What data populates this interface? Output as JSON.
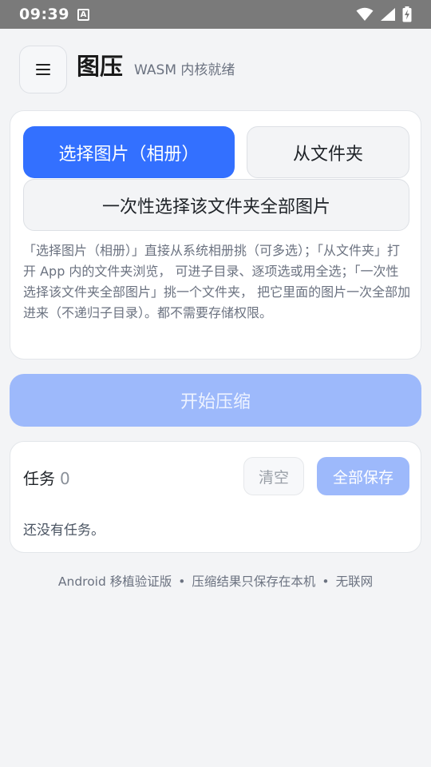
{
  "status_bar": {
    "time": "09:39",
    "notification_glyph": "A"
  },
  "header": {
    "title": "图压",
    "subtitle": "WASM 内核就绪"
  },
  "picker": {
    "pick_images_label": "选择图片（相册）",
    "from_folder_label": "从文件夹",
    "pick_whole_folder_label": "一次性选择该文件夹全部图片",
    "hint": "「选择图片（相册）」直接从系统相册挑（可多选）；「从文件夹」打开 App 内的文件夹浏览， 可进子目录、逐项选或用全选；「一次性选择该文件夹全部图片」挑一个文件夹， 把它里面的图片一次全部加进来（不递归子目录）。都不需要存储权限。"
  },
  "start_button_label": "开始压缩",
  "tasks": {
    "label": "任务",
    "count": "0",
    "clear_label": "清空",
    "save_all_label": "全部保存",
    "empty_text": "还没有任务。"
  },
  "footer": {
    "part1": "Android 移植验证版",
    "part2": "压缩结果只保存在本机",
    "part3": "无联网",
    "separator": "•"
  },
  "colors": {
    "primary": "#3370ff",
    "primary_disabled": "#9db9fb",
    "status_bar": "#7a7a7a",
    "background": "#f3f4f6"
  },
  "icons": {
    "menu": "hamburger-menu-icon",
    "wifi": "wifi-icon",
    "signal": "signal-icon",
    "battery": "battery-charging-icon"
  }
}
